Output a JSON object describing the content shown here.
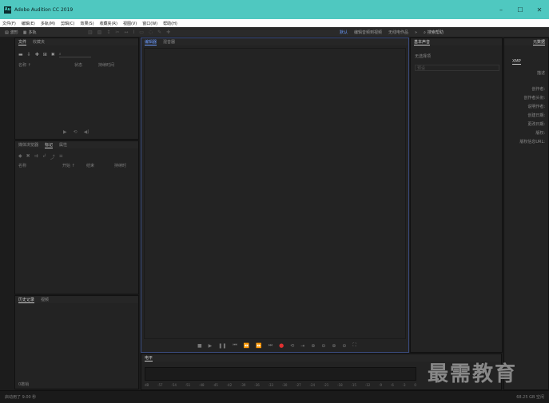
{
  "titlebar": {
    "app_icon": "Au",
    "title": "Adobe Audition CC 2019",
    "minimize": "–",
    "maximize": "☐",
    "close": "✕"
  },
  "menu": [
    "文件(F)",
    "编辑(E)",
    "多轨(M)",
    "剪辑(C)",
    "效果(S)",
    "收藏夹(R)",
    "视图(V)",
    "窗口(W)",
    "帮助(H)"
  ],
  "toolbar": {
    "waveform_label": "波形",
    "multitrack_label": "多轨",
    "right_items": [
      "默认",
      "编辑音频到视频",
      "无线电作品"
    ],
    "search_label": "搜索帮助"
  },
  "files_panel": {
    "tabs": [
      "文件",
      "收藏夹"
    ],
    "columns": [
      "名称 ↑",
      "状态",
      "持续时间"
    ]
  },
  "media_panel": {
    "tabs": [
      "媒体浏览器",
      "标记",
      "属性"
    ],
    "columns": [
      "名称",
      "开始 ↑",
      "结束",
      "持续时"
    ]
  },
  "history_panel": {
    "tabs": [
      "历史记录",
      "视频"
    ],
    "footer": "0撤销"
  },
  "editor_panel": {
    "tabs": [
      "编辑器",
      "混音器"
    ]
  },
  "essential_panel": {
    "tabs": [
      "基本声音"
    ],
    "subtitle": "无选择项",
    "preset_label": "预设"
  },
  "meta_panel": {
    "tab": "元数据",
    "sub": "XMP",
    "label": "描述",
    "rows": [
      "创作者:",
      "创作者头衔:",
      "说明作者:",
      "创建日期:",
      "更改日期:",
      "版权:",
      "版权信息URL:"
    ]
  },
  "levels_panel": {
    "tab": "电平",
    "ticks": [
      "dB",
      "-57",
      "-54",
      "-51",
      "-48",
      "-45",
      "-42",
      "-39",
      "-36",
      "-33",
      "-30",
      "-27",
      "-24",
      "-21",
      "-18",
      "-15",
      "-12",
      "-9",
      "-6",
      "-3",
      "0"
    ]
  },
  "statusbar": {
    "left": "启动用了 9.00 秒",
    "right": "68.25 GB 空闲"
  },
  "watermark": "最需教育",
  "colors": {
    "titlebar": "#4fc8c0",
    "accent": "#6b9bff",
    "record": "#e03030"
  }
}
